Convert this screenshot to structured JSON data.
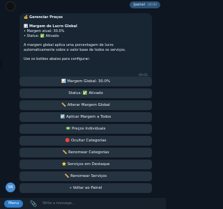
{
  "chat": {
    "user_message": {
      "text": "/painel",
      "time": "00:00"
    },
    "bot_message": {
      "title": "💰 Gerenciar Preços",
      "section_title": "📊 Margem de Lucro Global",
      "current_margin_label": "• Margem atual: 30.0%",
      "status_label": "• Status: ✅ Ativado",
      "description_1": "A margem global aplica uma porcentagem de lucro",
      "description_2": "automaticamente sobre o valor base de todos os serviços.",
      "prompt": "Use os botões abaixo para configurar:",
      "time": "00:01"
    },
    "keyboard": [
      "📊 Margem Global: 30.0%",
      "Status: ✅ Ativado",
      "✏️ Alterar Margem Global",
      "☑️ Aplicar Margem a Todos",
      "💵 Preços Individuais",
      "🔴 Ocultar Categorias",
      "✏️ Renomear Categorias",
      "⭐ Serviços em Destaque",
      "✏️ Renomear Serviços",
      "« Voltar ao Painel"
    ],
    "bot_avatar": "SN"
  },
  "input_bar": {
    "menu_label": "Menu",
    "attach_icon": "paperclip-icon",
    "placeholder": "Write a message..."
  }
}
